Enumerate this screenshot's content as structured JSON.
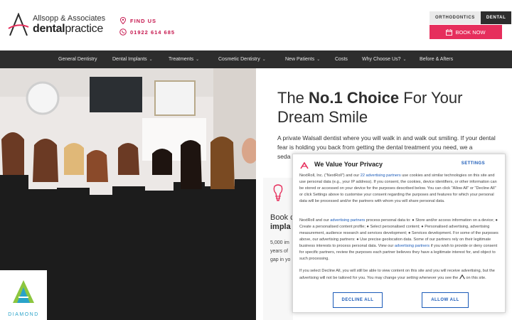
{
  "header": {
    "logo_line1": "Allsopp & Associates",
    "logo_line2_a": "dental",
    "logo_line2_b": "practice",
    "find_us": "FIND US",
    "phone": "01922 614 685",
    "tab_orthodontics": "ORTHODONTICS",
    "tab_dental": "DENTAL",
    "book_now": "BOOK NOW"
  },
  "nav": {
    "items": [
      {
        "label": "General Dentistry",
        "dropdown": false
      },
      {
        "label": "Dental Implants",
        "dropdown": true
      },
      {
        "label": "Treatments",
        "dropdown": true
      },
      {
        "label": "Cosmetic Dentistry",
        "dropdown": true
      },
      {
        "label": "New Patients",
        "dropdown": true
      },
      {
        "label": "Costs",
        "dropdown": false
      },
      {
        "label": "Why Choose Us?",
        "dropdown": true
      },
      {
        "label": "Before & Afters",
        "dropdown": false
      }
    ]
  },
  "hero": {
    "headline_pre": "The ",
    "headline_bold": "No.1 Choice",
    "headline_post": " For Your Dream Smile",
    "intro": "A private Walsall dentist where you will walk in and walk out smiling. If your dental fear is holding you back from getting the dental treatment you need, we a",
    "intro_line3": "seda",
    "diamond_label": "DIAMOND"
  },
  "card": {
    "title_a": "Book c",
    "title_b": "impla",
    "body": [
      "5,000 im",
      "years of",
      "gap in yo"
    ]
  },
  "consent": {
    "title": "We Value Your Privacy",
    "settings": "SETTINGS",
    "p1_a": "NextRoll, Inc. (\"NextRoll\") and our ",
    "p1_link": "22 advertising partners",
    "p1_b": " use cookies and similar technologies on this site and use personal data (e.g., your IP address). If you consent, the cookies, device identifiers, or other information can be stored or accessed on your device for the purposes described below. You can click \"Allow All\" or \"Decline All\" or click Settings above to customise your consent regarding the purposes and features for which your personal data will be processed and/or the partners with whom you will share personal data.",
    "p2_a": "NextRoll and our ",
    "p2_link": "advertising partners",
    "p2_b": " process personal data to: ● Store and/or access information on a device; ● Create a personalised content profile; ● Select personalised content; ● Personalised advertising, advertising measurement, audience research and services development; ● Services development. For some of the purposes above, our advertising partners: ● Use precise geolocation data. Some of our partners rely on their legitimate business interests to process personal data. View our ",
    "p2_link2": "advertising partners",
    "p2_c": " if you wish to provide or deny consent for specific partners, review the purposes each partner believes they have a legitimate interest for, and object to such processing.",
    "p3_a": "If you select Decline All, you will still be able to view content on this site and you will receive advertising, but the advertising will not be tailored for you. You may change your setting whenever you see the",
    "p3_b": " on this site.",
    "decline": "DECLINE ALL",
    "allow": "ALLOW ALL"
  },
  "colors": {
    "accent_pink": "#e62e5c",
    "contact_pink": "#c6174e",
    "nav_bg": "#2d2d2d",
    "consent_blue": "#1a5ab8",
    "diamond_teal": "#2aa3c9"
  }
}
